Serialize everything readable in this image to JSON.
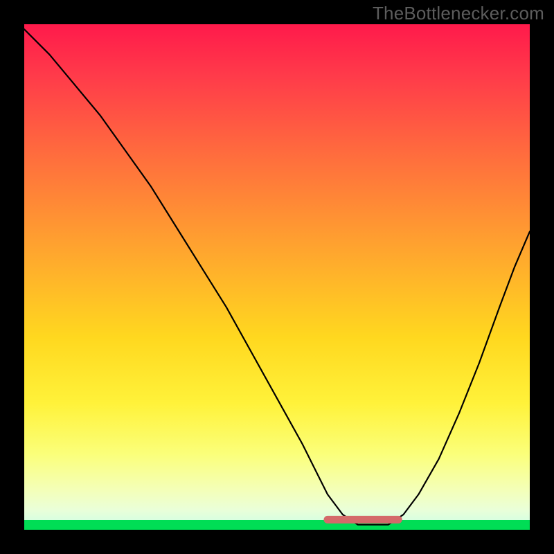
{
  "watermark": "TheBottleneсker.com",
  "chart_data": {
    "type": "line",
    "title": "",
    "xlabel": "",
    "ylabel": "",
    "xlim": [
      0,
      100
    ],
    "ylim": [
      0,
      100
    ],
    "grid": false,
    "series": [
      {
        "name": "bottleneck-curve",
        "x": [
          0,
          5,
          10,
          15,
          20,
          25,
          30,
          35,
          40,
          45,
          50,
          55,
          58,
          60,
          63,
          66,
          69,
          72,
          75,
          78,
          82,
          86,
          90,
          94,
          97,
          100
        ],
        "values": [
          99,
          94,
          88,
          82,
          75,
          68,
          60,
          52,
          44,
          35,
          26,
          17,
          11,
          7,
          3,
          1,
          1,
          1,
          3,
          7,
          14,
          23,
          33,
          44,
          52,
          59
        ]
      }
    ],
    "highlight_segment": {
      "name": "optimal-zone",
      "x_start": 60,
      "x_end": 74,
      "y": 2,
      "color": "#d46a6a"
    },
    "background_gradient": {
      "direction": "vertical",
      "stops": [
        {
          "pos": 0.0,
          "color": "#ff1a4b"
        },
        {
          "pos": 0.45,
          "color": "#ffa62e"
        },
        {
          "pos": 0.75,
          "color": "#fff23a"
        },
        {
          "pos": 0.96,
          "color": "#eaffd8"
        },
        {
          "pos": 0.985,
          "color": "#00dd55"
        },
        {
          "pos": 1.0,
          "color": "#ffffff"
        }
      ]
    }
  }
}
